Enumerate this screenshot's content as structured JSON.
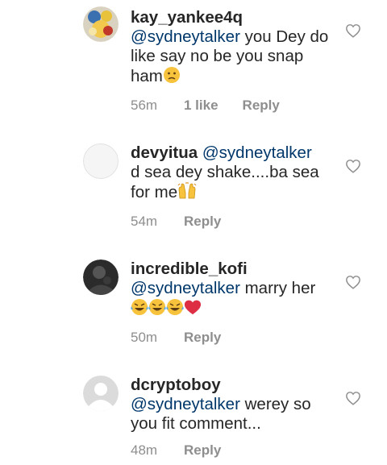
{
  "comments": [
    {
      "username": "kay_yankee4q",
      "mention": "@sydneytalker",
      "text": "you Dey do like say no be you snap ham",
      "emoji": "confused-face",
      "time": "56m",
      "likes": "1 like",
      "reply": "Reply"
    },
    {
      "username": "devyitua",
      "mention": "@sydneytalker",
      "text": "d sea dey shake....ba sea for me",
      "emoji": "raising-hands",
      "time": "54m",
      "reply": "Reply"
    },
    {
      "username": "incredible_kofi",
      "mention": "@sydneytalker",
      "text": "marry her",
      "emoji": "laughing-tears x3, red-heart",
      "time": "50m",
      "reply": "Reply"
    },
    {
      "username": "dcryptoboy",
      "mention": "@sydneytalker",
      "text": "werey so you fit comment...",
      "time": "48m",
      "reply": "Reply"
    }
  ],
  "icons": {
    "like": "heart-outline-icon"
  },
  "colors": {
    "mention": "#00376b",
    "meta": "#8e8e8e",
    "text": "#262626"
  }
}
